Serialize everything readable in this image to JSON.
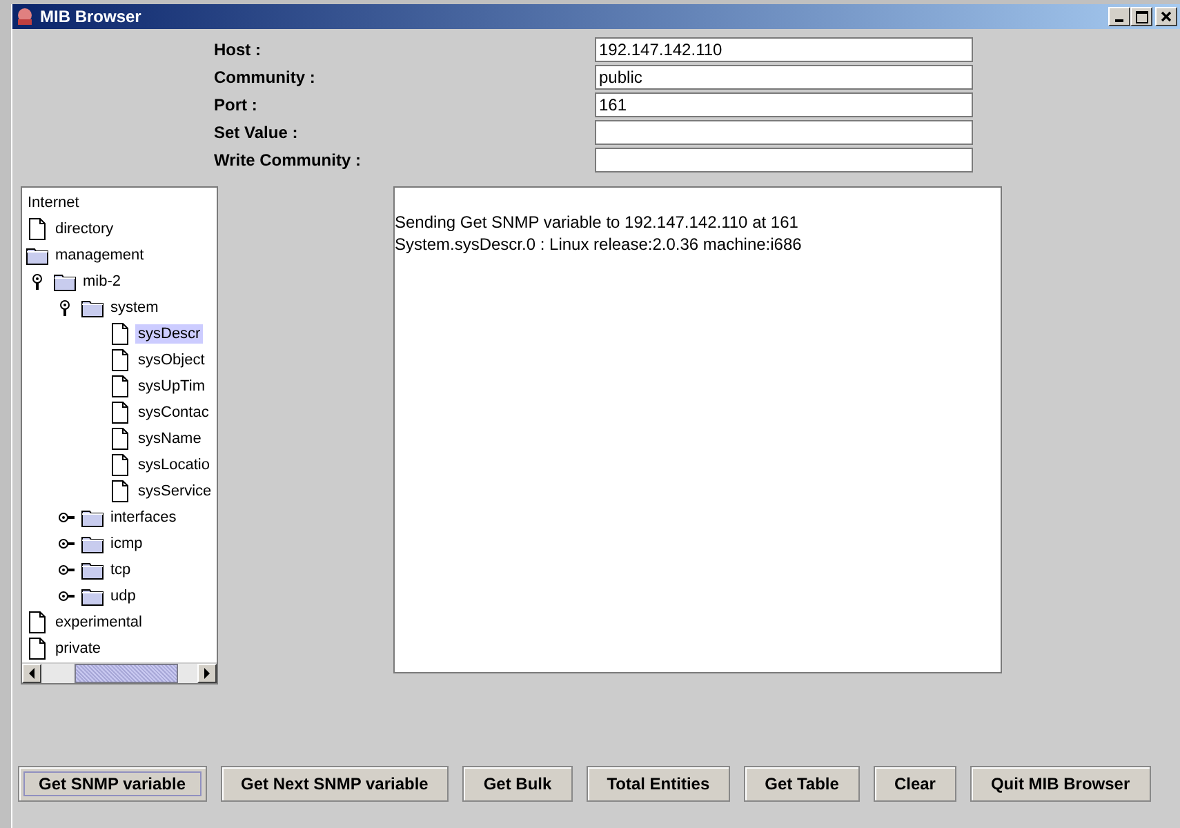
{
  "window": {
    "title": "MIB Browser"
  },
  "form": [
    {
      "label": "Host :",
      "value": "192.147.142.110"
    },
    {
      "label": "Community :",
      "value": "public"
    },
    {
      "label": "Port :",
      "value": "161"
    },
    {
      "label": "Set Value :"
    },
    {
      "label": "Write Community :"
    }
  ],
  "tree": {
    "label": "Internet",
    "children": [
      {
        "label": "directory",
        "kind": "leaf",
        "selected": false
      },
      {
        "label": "management",
        "kind": "folder",
        "selected": false,
        "children": [
          {
            "label": "mib-2",
            "kind": "folder",
            "expanded": true,
            "selected": false,
            "children": [
              {
                "label": "system",
                "kind": "folder",
                "expanded": true,
                "selected": false,
                "children": [
                  {
                    "label": "sysDescr",
                    "kind": "leaf",
                    "selected": true
                  },
                  {
                    "label": "sysObject",
                    "kind": "leaf",
                    "selected": false
                  },
                  {
                    "label": "sysUpTim",
                    "kind": "leaf",
                    "selected": false
                  },
                  {
                    "label": "sysContac",
                    "kind": "leaf",
                    "selected": false
                  },
                  {
                    "label": "sysName",
                    "kind": "leaf",
                    "selected": false
                  },
                  {
                    "label": "sysLocatio",
                    "kind": "leaf",
                    "selected": false
                  },
                  {
                    "label": "sysService",
                    "kind": "leaf",
                    "selected": false
                  }
                ]
              },
              {
                "label": "interfaces",
                "kind": "folder",
                "expanded": false,
                "selected": false
              },
              {
                "label": "icmp",
                "kind": "folder",
                "expanded": false,
                "selected": false
              },
              {
                "label": "tcp",
                "kind": "folder",
                "expanded": false,
                "selected": false
              },
              {
                "label": "udp",
                "kind": "folder",
                "expanded": false,
                "selected": false
              }
            ]
          }
        ]
      },
      {
        "label": "experimental",
        "kind": "leaf",
        "selected": false
      },
      {
        "label": "private",
        "kind": "leaf",
        "selected": false
      }
    ]
  },
  "output": [
    "Sending Get SNMP variable to 192.147.142.110 at 161",
    "System.sysDescr.0 : Linux release:2.0.36 machine:i686"
  ],
  "buttons": [
    {
      "label": "Get SNMP variable",
      "focused": true
    },
    {
      "label": "Get Next SNMP variable",
      "focused": false
    },
    {
      "label": "Get Bulk",
      "focused": false
    },
    {
      "label": "Total Entities",
      "focused": false
    },
    {
      "label": "Get Table",
      "focused": false
    },
    {
      "label": "Clear",
      "focused": false
    },
    {
      "label": "Quit MIB Browser",
      "focused": false
    }
  ]
}
